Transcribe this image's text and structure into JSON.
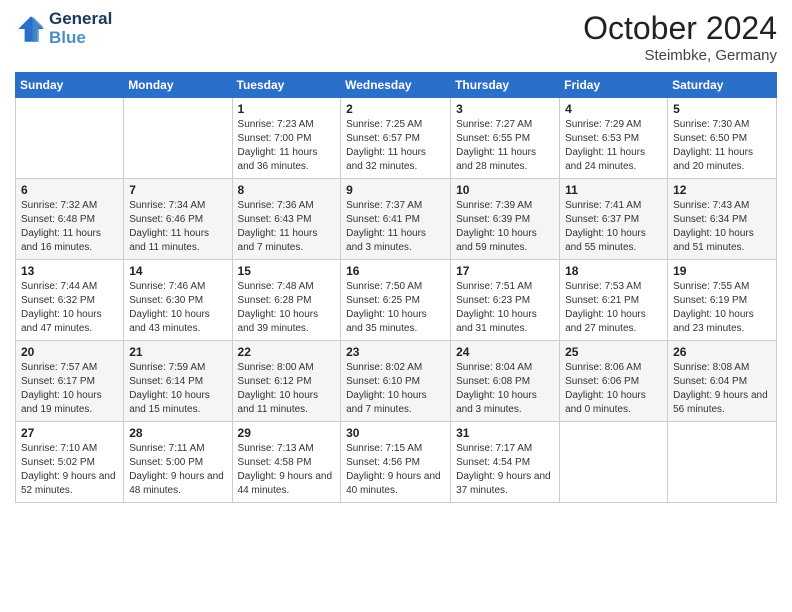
{
  "header": {
    "logo_line1": "General",
    "logo_line2": "Blue",
    "month_title": "October 2024",
    "location": "Steimbke, Germany"
  },
  "weekdays": [
    "Sunday",
    "Monday",
    "Tuesday",
    "Wednesday",
    "Thursday",
    "Friday",
    "Saturday"
  ],
  "weeks": [
    [
      {
        "day": "",
        "sunrise": "",
        "sunset": "",
        "daylight": ""
      },
      {
        "day": "",
        "sunrise": "",
        "sunset": "",
        "daylight": ""
      },
      {
        "day": "1",
        "sunrise": "Sunrise: 7:23 AM",
        "sunset": "Sunset: 7:00 PM",
        "daylight": "Daylight: 11 hours and 36 minutes."
      },
      {
        "day": "2",
        "sunrise": "Sunrise: 7:25 AM",
        "sunset": "Sunset: 6:57 PM",
        "daylight": "Daylight: 11 hours and 32 minutes."
      },
      {
        "day": "3",
        "sunrise": "Sunrise: 7:27 AM",
        "sunset": "Sunset: 6:55 PM",
        "daylight": "Daylight: 11 hours and 28 minutes."
      },
      {
        "day": "4",
        "sunrise": "Sunrise: 7:29 AM",
        "sunset": "Sunset: 6:53 PM",
        "daylight": "Daylight: 11 hours and 24 minutes."
      },
      {
        "day": "5",
        "sunrise": "Sunrise: 7:30 AM",
        "sunset": "Sunset: 6:50 PM",
        "daylight": "Daylight: 11 hours and 20 minutes."
      }
    ],
    [
      {
        "day": "6",
        "sunrise": "Sunrise: 7:32 AM",
        "sunset": "Sunset: 6:48 PM",
        "daylight": "Daylight: 11 hours and 16 minutes."
      },
      {
        "day": "7",
        "sunrise": "Sunrise: 7:34 AM",
        "sunset": "Sunset: 6:46 PM",
        "daylight": "Daylight: 11 hours and 11 minutes."
      },
      {
        "day": "8",
        "sunrise": "Sunrise: 7:36 AM",
        "sunset": "Sunset: 6:43 PM",
        "daylight": "Daylight: 11 hours and 7 minutes."
      },
      {
        "day": "9",
        "sunrise": "Sunrise: 7:37 AM",
        "sunset": "Sunset: 6:41 PM",
        "daylight": "Daylight: 11 hours and 3 minutes."
      },
      {
        "day": "10",
        "sunrise": "Sunrise: 7:39 AM",
        "sunset": "Sunset: 6:39 PM",
        "daylight": "Daylight: 10 hours and 59 minutes."
      },
      {
        "day": "11",
        "sunrise": "Sunrise: 7:41 AM",
        "sunset": "Sunset: 6:37 PM",
        "daylight": "Daylight: 10 hours and 55 minutes."
      },
      {
        "day": "12",
        "sunrise": "Sunrise: 7:43 AM",
        "sunset": "Sunset: 6:34 PM",
        "daylight": "Daylight: 10 hours and 51 minutes."
      }
    ],
    [
      {
        "day": "13",
        "sunrise": "Sunrise: 7:44 AM",
        "sunset": "Sunset: 6:32 PM",
        "daylight": "Daylight: 10 hours and 47 minutes."
      },
      {
        "day": "14",
        "sunrise": "Sunrise: 7:46 AM",
        "sunset": "Sunset: 6:30 PM",
        "daylight": "Daylight: 10 hours and 43 minutes."
      },
      {
        "day": "15",
        "sunrise": "Sunrise: 7:48 AM",
        "sunset": "Sunset: 6:28 PM",
        "daylight": "Daylight: 10 hours and 39 minutes."
      },
      {
        "day": "16",
        "sunrise": "Sunrise: 7:50 AM",
        "sunset": "Sunset: 6:25 PM",
        "daylight": "Daylight: 10 hours and 35 minutes."
      },
      {
        "day": "17",
        "sunrise": "Sunrise: 7:51 AM",
        "sunset": "Sunset: 6:23 PM",
        "daylight": "Daylight: 10 hours and 31 minutes."
      },
      {
        "day": "18",
        "sunrise": "Sunrise: 7:53 AM",
        "sunset": "Sunset: 6:21 PM",
        "daylight": "Daylight: 10 hours and 27 minutes."
      },
      {
        "day": "19",
        "sunrise": "Sunrise: 7:55 AM",
        "sunset": "Sunset: 6:19 PM",
        "daylight": "Daylight: 10 hours and 23 minutes."
      }
    ],
    [
      {
        "day": "20",
        "sunrise": "Sunrise: 7:57 AM",
        "sunset": "Sunset: 6:17 PM",
        "daylight": "Daylight: 10 hours and 19 minutes."
      },
      {
        "day": "21",
        "sunrise": "Sunrise: 7:59 AM",
        "sunset": "Sunset: 6:14 PM",
        "daylight": "Daylight: 10 hours and 15 minutes."
      },
      {
        "day": "22",
        "sunrise": "Sunrise: 8:00 AM",
        "sunset": "Sunset: 6:12 PM",
        "daylight": "Daylight: 10 hours and 11 minutes."
      },
      {
        "day": "23",
        "sunrise": "Sunrise: 8:02 AM",
        "sunset": "Sunset: 6:10 PM",
        "daylight": "Daylight: 10 hours and 7 minutes."
      },
      {
        "day": "24",
        "sunrise": "Sunrise: 8:04 AM",
        "sunset": "Sunset: 6:08 PM",
        "daylight": "Daylight: 10 hours and 3 minutes."
      },
      {
        "day": "25",
        "sunrise": "Sunrise: 8:06 AM",
        "sunset": "Sunset: 6:06 PM",
        "daylight": "Daylight: 10 hours and 0 minutes."
      },
      {
        "day": "26",
        "sunrise": "Sunrise: 8:08 AM",
        "sunset": "Sunset: 6:04 PM",
        "daylight": "Daylight: 9 hours and 56 minutes."
      }
    ],
    [
      {
        "day": "27",
        "sunrise": "Sunrise: 7:10 AM",
        "sunset": "Sunset: 5:02 PM",
        "daylight": "Daylight: 9 hours and 52 minutes."
      },
      {
        "day": "28",
        "sunrise": "Sunrise: 7:11 AM",
        "sunset": "Sunset: 5:00 PM",
        "daylight": "Daylight: 9 hours and 48 minutes."
      },
      {
        "day": "29",
        "sunrise": "Sunrise: 7:13 AM",
        "sunset": "Sunset: 4:58 PM",
        "daylight": "Daylight: 9 hours and 44 minutes."
      },
      {
        "day": "30",
        "sunrise": "Sunrise: 7:15 AM",
        "sunset": "Sunset: 4:56 PM",
        "daylight": "Daylight: 9 hours and 40 minutes."
      },
      {
        "day": "31",
        "sunrise": "Sunrise: 7:17 AM",
        "sunset": "Sunset: 4:54 PM",
        "daylight": "Daylight: 9 hours and 37 minutes."
      },
      {
        "day": "",
        "sunrise": "",
        "sunset": "",
        "daylight": ""
      },
      {
        "day": "",
        "sunrise": "",
        "sunset": "",
        "daylight": ""
      }
    ]
  ]
}
